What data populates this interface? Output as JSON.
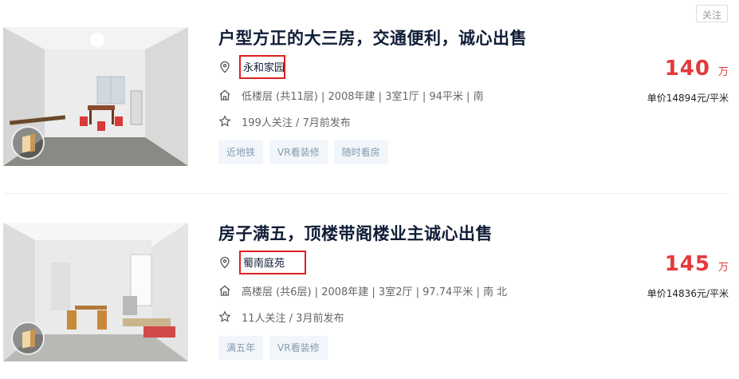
{
  "follow_button": "关注",
  "listings": [
    {
      "title": "户型方正的大三房，交通便利，诚心出售",
      "community": "永和家园",
      "house_info": "低楼层 (共11层) | 2008年建 | 3室1厅 | 94平米 | 南",
      "follow_info": "199人关注 / 7月前发布",
      "tags": [
        "近地铁",
        "VR看装修",
        "随时看房"
      ],
      "total_price": "140",
      "price_unit": "万",
      "unit_price": "单价14894元/平米"
    },
    {
      "title": "房子满五，顶楼带阁楼业主诚心出售",
      "community": "蜀南庭苑",
      "house_info": "高楼层 (共6层) | 2008年建 | 3室2厅 | 97.74平米 | 南 北",
      "follow_info": "11人关注 / 3月前发布",
      "tags": [
        "满五年",
        "VR看装修"
      ],
      "total_price": "145",
      "price_unit": "万",
      "unit_price": "单价14836元/平米"
    }
  ],
  "icons": {
    "address": "location-pin-icon",
    "house": "house-icon",
    "follow": "star-icon",
    "vr": "vr-door-icon"
  },
  "colors": {
    "price": "#e4393c",
    "title": "#101d37",
    "tag_bg": "#f2f6fb",
    "tag_text": "#849aae",
    "highlight_box": "#e02020"
  }
}
